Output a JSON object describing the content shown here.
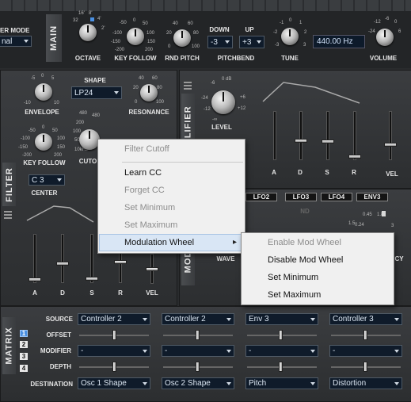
{
  "top": {
    "filter_mode_label": "ER MODE",
    "filter_mode_value": "nal",
    "main_tab": "MAIN",
    "octave": {
      "label": "OCTAVE",
      "ticks": [
        "32",
        "16'",
        "8'",
        "4'",
        "2'"
      ]
    },
    "key_follow": {
      "label": "KEY FOLLOW",
      "ticks": [
        "-50",
        "0",
        "50",
        "-100",
        "100",
        "-150",
        "150",
        "-200",
        "200"
      ]
    },
    "rnd_pitch": {
      "label": "RND PITCH",
      "ticks": [
        "40",
        "60",
        "20",
        "80",
        "0",
        "100"
      ]
    },
    "pitchbend": {
      "label": "PITCHBEND",
      "down_label": "DOWN",
      "up_label": "UP",
      "down_value": "-3",
      "up_value": "+3"
    },
    "tune": {
      "label": "TUNE",
      "ticks": [
        "-1",
        "0",
        "1",
        "-2",
        "2",
        "-3",
        "3"
      ],
      "value": "440.00 Hz"
    },
    "volume": {
      "label": "VOLUME",
      "ticks": [
        "-12",
        "-6",
        "0",
        "-24",
        "6"
      ]
    }
  },
  "filter": {
    "tab": "FILTER",
    "envelope": {
      "label": "ENVELOPE",
      "ticks": [
        "-5",
        "0",
        "5",
        "-10",
        "10"
      ]
    },
    "shape": {
      "label": "SHAPE",
      "value": "LP24"
    },
    "resonance": {
      "label": "RESONANCE",
      "ticks": [
        "40",
        "60",
        "20",
        "80",
        "0",
        "100"
      ]
    },
    "key_follow": {
      "label": "KEY FOLLOW",
      "ticks": [
        "-50",
        "0",
        "50",
        "-100",
        "100",
        "-150",
        "150",
        "-200",
        "200"
      ]
    },
    "cutoff": {
      "label": "CUTO",
      "ticks": [
        "480",
        "200",
        "100",
        "50",
        "10",
        "10kHz"
      ]
    },
    "center": {
      "label": "CENTER",
      "value": "C 3"
    },
    "env_labels": [
      "A",
      "D",
      "S",
      "R",
      "VEL"
    ]
  },
  "amplifier": {
    "tab": "PLIFIER",
    "level": {
      "label": "LEVEL",
      "ticks": [
        "0 dB",
        "-6",
        "-12",
        "-24",
        "+6",
        "+12",
        "-∞"
      ]
    },
    "env_labels": [
      "A",
      "D",
      "S",
      "R",
      "VEL"
    ]
  },
  "lfo": {
    "tab": "MOD",
    "tabs": [
      "LFO2",
      "LFO3",
      "LFO4",
      "ENV3"
    ],
    "wave_label": "WAVE",
    "freq_label": "CY",
    "ticks": [
      "1.5",
      "0.45",
      "1.8",
      "0.24",
      "3"
    ],
    "nd_label": "ND"
  },
  "matrix": {
    "tab": "MATRIX",
    "rows": [
      "SOURCE",
      "OFFSET",
      "MODIFIER",
      "DEPTH",
      "DESTINATION"
    ],
    "numbers": [
      "1",
      "2",
      "3",
      "4"
    ],
    "slots": [
      {
        "source": "Controller 2",
        "modifier": "-",
        "destination": "Osc 1 Shape"
      },
      {
        "source": "Controller 2",
        "modifier": "-",
        "destination": "Osc 2 Shape"
      },
      {
        "source": "Env 3",
        "modifier": "-",
        "destination": "Pitch"
      },
      {
        "source": "Controller 3",
        "modifier": "-",
        "destination": "Distortion"
      }
    ]
  },
  "context_menu": {
    "title": "Filter Cutoff",
    "items": [
      "Learn CC",
      "Forget CC",
      "Set Minimum",
      "Set Maximum",
      "Modulation Wheel"
    ],
    "submenu_arrow": "▸"
  },
  "submenu": {
    "items": [
      "Enable Mod Wheel",
      "Disable Mod Wheel",
      "Set Minimum",
      "Set Maximum"
    ]
  },
  "colors": {
    "accent": "#4a90e2",
    "lcd_bg": "#0d1a2a",
    "menu_bg": "#f0f0f0"
  }
}
